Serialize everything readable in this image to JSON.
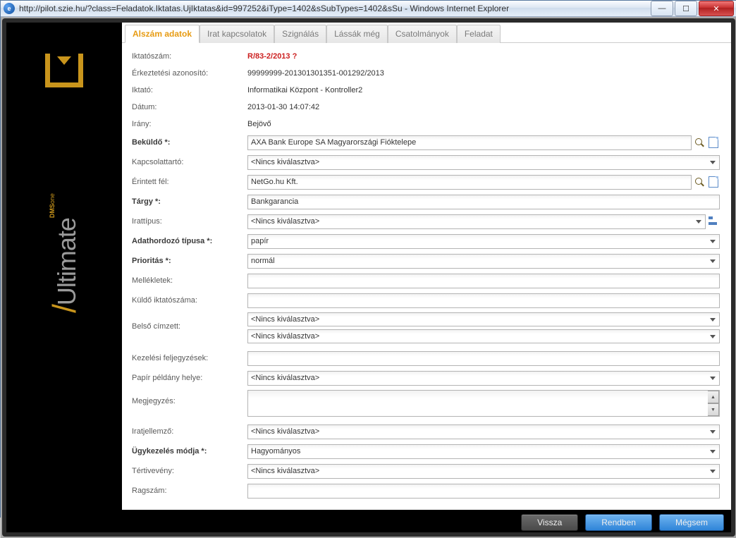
{
  "window": {
    "title": "http://pilot.szie.hu/?class=Feladatok.Iktatas.UjIktatas&id=997252&iType=1402&sSubTypes=1402&sSu - Windows Internet Explorer",
    "favicon_letter": "e"
  },
  "brand": {
    "slash": "/",
    "name": "Ultimate",
    "suite_one": "one",
    "suite_dms": "DMS"
  },
  "tabs": [
    {
      "label": "Alszám adatok",
      "active": true
    },
    {
      "label": "Irat kapcsolatok",
      "active": false
    },
    {
      "label": "Szignálás",
      "active": false
    },
    {
      "label": "Lássák még",
      "active": false
    },
    {
      "label": "Csatolmányok",
      "active": false
    },
    {
      "label": "Feladat",
      "active": false
    }
  ],
  "labels": {
    "iktatoszam": "Iktatószám:",
    "erkeztetesi": "Érkeztetési azonosító:",
    "iktato": "Iktató:",
    "datum": "Dátum:",
    "irany": "Irány:",
    "bekuldo": "Beküldő *:",
    "kapcsolattarto": "Kapcsolattartó:",
    "erintett": "Érintett fél:",
    "targy": "Tárgy *:",
    "irattipus": "Irattípus:",
    "adath": "Adathordozó típusa *:",
    "prioritas": "Prioritás *:",
    "mellekletek": "Mellékletek:",
    "kuldo_ikt": "Küldő iktatószáma:",
    "belso": "Belső címzett:",
    "kezelesi": "Kezelési feljegyzések:",
    "papir_hely": "Papír példány helye:",
    "megj": "Megjegyzés:",
    "iratjell": "Iratjellemző:",
    "ugykez": "Ügykezelés módja *:",
    "tertiv": "Tértivevény:",
    "ragszam": "Ragszám:"
  },
  "values": {
    "iktatoszam": "R/83-2/2013 ?",
    "erkeztetesi": "99999999-201301301351-001292/2013",
    "iktato": "Informatikai Központ - Kontroller2",
    "datum": "2013-01-30 14:07:42",
    "irany": "Bejövő",
    "bekuldo": "AXA Bank Europe SA Magyarországi Fióktelepe",
    "kapcsolattarto": "<Nincs kiválasztva>",
    "erintett": "NetGo.hu Kft.",
    "targy": "Bankgarancia",
    "irattipus": "<Nincs kiválasztva>",
    "adath": "papír",
    "prioritas": "normál",
    "mellekletek": "",
    "kuldo_ikt": "",
    "belso1": "<Nincs kiválasztva>",
    "belso2": "<Nincs kiválasztva>",
    "kezelesi": "",
    "papir_hely": "<Nincs kiválasztva>",
    "megj": "",
    "iratjell": "<Nincs kiválasztva>",
    "ugykez": "Hagyományos",
    "tertiv": "<Nincs kiválasztva>",
    "ragszam": ""
  },
  "buttons": {
    "vissza": "Vissza",
    "rendben": "Rendben",
    "megsem": "Mégsem"
  }
}
